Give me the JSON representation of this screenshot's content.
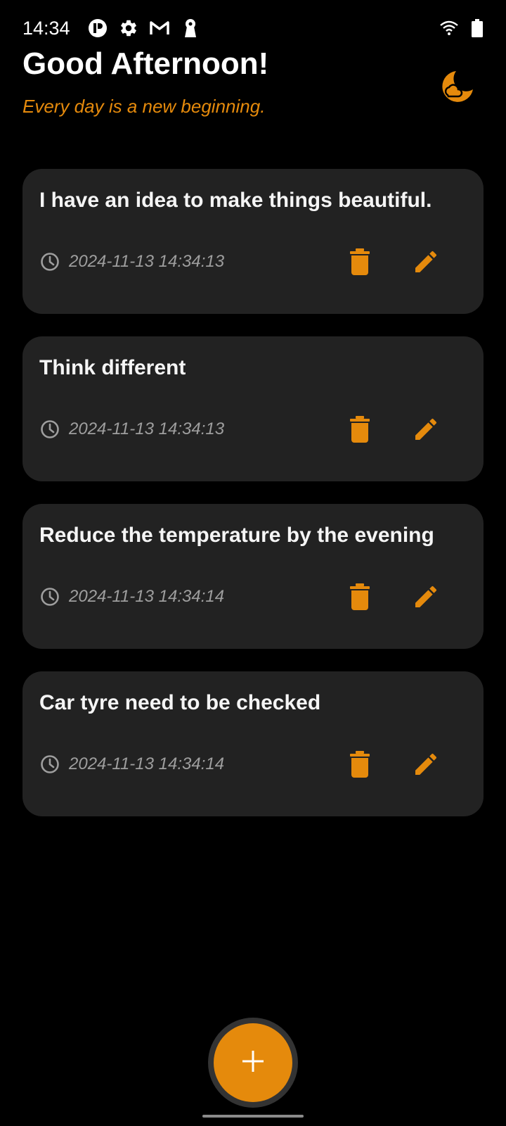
{
  "status_bar": {
    "time": "14:34",
    "left_icons": [
      "pi-icon",
      "settings-icon",
      "gmail-icon",
      "keyhole-icon"
    ],
    "right_icons": [
      "wifi-icon",
      "battery-icon"
    ]
  },
  "header": {
    "greeting": "Good Afternoon!",
    "subtitle": "Every day is a new beginning.",
    "theme_toggle_icon": "moon-cloud-icon"
  },
  "notes": [
    {
      "title": "I have an idea to make things beautiful.",
      "date": "2024-11-13 14:34:13"
    },
    {
      "title": "Think different",
      "date": "2024-11-13 14:34:13"
    },
    {
      "title": "Reduce the temperature by the evening",
      "date": "2024-11-13 14:34:14"
    },
    {
      "title": "Car tyre need to be checked",
      "date": "2024-11-13 14:34:14"
    }
  ],
  "fab": {
    "icon": "plus-icon"
  },
  "colors": {
    "accent": "#e58a0c",
    "background": "#000000",
    "card": "#222222",
    "date_text": "#9e9e9e"
  }
}
